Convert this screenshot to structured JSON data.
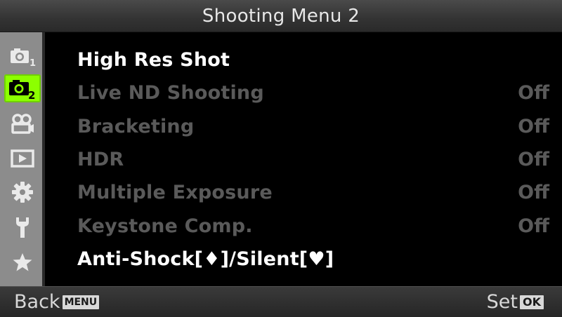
{
  "header": {
    "title": "Shooting Menu 2"
  },
  "sidebar": {
    "tabs": [
      {
        "icon": "camera-1-icon",
        "sub": "1"
      },
      {
        "icon": "camera-2-icon",
        "sub": "2"
      },
      {
        "icon": "video-camera-icon"
      },
      {
        "icon": "playback-icon"
      },
      {
        "icon": "gear-icon"
      },
      {
        "icon": "wrench-icon"
      },
      {
        "icon": "star-icon"
      }
    ],
    "active_tab": "camera-2-icon",
    "active_color": "#8cff00"
  },
  "menu": {
    "items": [
      {
        "label": "High Res Shot",
        "value": ""
      },
      {
        "label": "Live ND Shooting",
        "value": "Off"
      },
      {
        "label": "Bracketing",
        "value": "Off"
      },
      {
        "label": "HDR",
        "value": "Off"
      },
      {
        "label": "Multiple Exposure",
        "value": "Off"
      },
      {
        "label": "Keystone Comp.",
        "value": "Off"
      },
      {
        "label": "Anti-Shock[♦]/Silent[♥]",
        "value": ""
      }
    ]
  },
  "footer": {
    "back_label": "Back",
    "back_button": "MENU",
    "set_label": "Set",
    "set_button": "OK"
  }
}
